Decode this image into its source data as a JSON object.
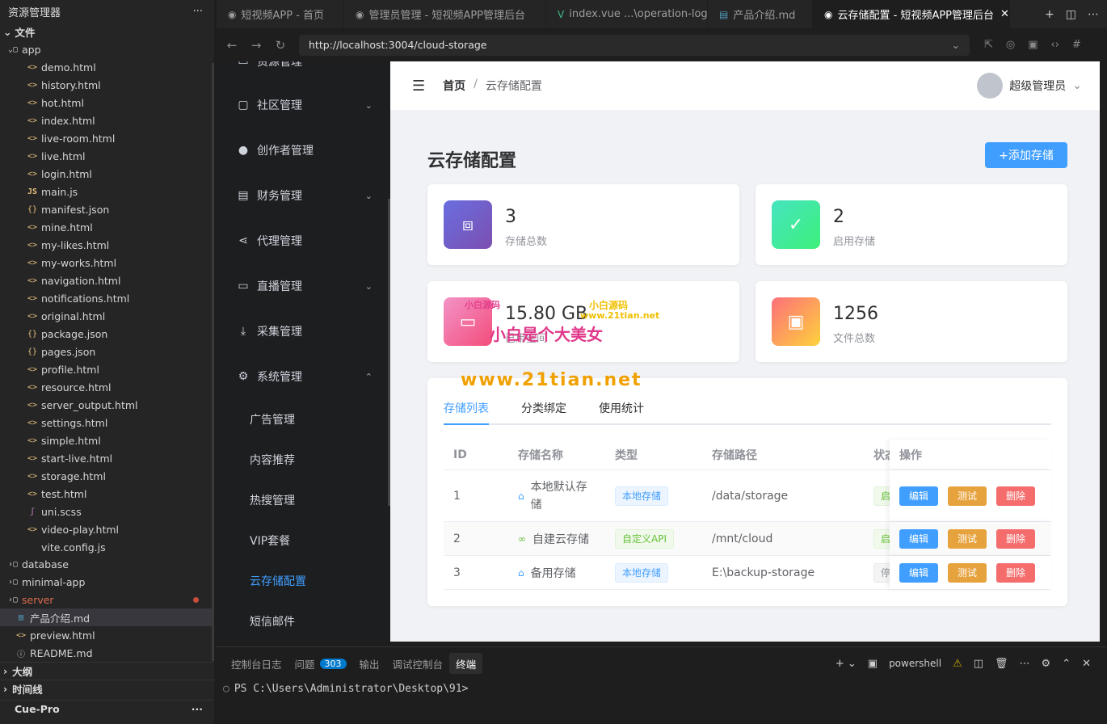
{
  "explorer": {
    "title": "资源管理器",
    "more": "···",
    "section": "文件",
    "folder_app": "app",
    "files": [
      {
        "name": "demo.html",
        "kind": "html"
      },
      {
        "name": "history.html",
        "kind": "html"
      },
      {
        "name": "hot.html",
        "kind": "html"
      },
      {
        "name": "index.html",
        "kind": "html"
      },
      {
        "name": "live-room.html",
        "kind": "html"
      },
      {
        "name": "live.html",
        "kind": "html"
      },
      {
        "name": "login.html",
        "kind": "html"
      },
      {
        "name": "main.js",
        "kind": "js"
      },
      {
        "name": "manifest.json",
        "kind": "json"
      },
      {
        "name": "mine.html",
        "kind": "html"
      },
      {
        "name": "my-likes.html",
        "kind": "html"
      },
      {
        "name": "my-works.html",
        "kind": "html"
      },
      {
        "name": "navigation.html",
        "kind": "html"
      },
      {
        "name": "notifications.html",
        "kind": "html"
      },
      {
        "name": "original.html",
        "kind": "html"
      },
      {
        "name": "package.json",
        "kind": "json"
      },
      {
        "name": "pages.json",
        "kind": "json"
      },
      {
        "name": "profile.html",
        "kind": "html"
      },
      {
        "name": "resource.html",
        "kind": "html"
      },
      {
        "name": "server_output.html",
        "kind": "html"
      },
      {
        "name": "settings.html",
        "kind": "html"
      },
      {
        "name": "simple.html",
        "kind": "html"
      },
      {
        "name": "start-live.html",
        "kind": "html"
      },
      {
        "name": "storage.html",
        "kind": "html"
      },
      {
        "name": "test.html",
        "kind": "html"
      },
      {
        "name": "uni.scss",
        "kind": "scss"
      },
      {
        "name": "video-play.html",
        "kind": "html"
      },
      {
        "name": "vite.config.js",
        "kind": "none"
      }
    ],
    "folders": [
      "database",
      "minimal-app",
      "server"
    ],
    "root_files": [
      "产品介绍.md",
      "preview.html",
      "README.md"
    ],
    "outline": "大纲",
    "timeline": "时间线",
    "cue_pro": "Cue-Pro"
  },
  "tabs": [
    {
      "label": "短视频APP - 首页"
    },
    {
      "label": "管理员管理 - 短视频APP管理后台"
    },
    {
      "label": "index.vue  ...\\operation-log"
    },
    {
      "label": "产品介绍.md"
    },
    {
      "label": "云存储配置 - 短视频APP管理后台"
    }
  ],
  "address": {
    "url": "http://localhost:3004/cloud-storage"
  },
  "sidebar": {
    "partial": "资源管理",
    "items": [
      {
        "label": "社区管理"
      },
      {
        "label": "创作者管理"
      },
      {
        "label": "财务管理"
      },
      {
        "label": "代理管理"
      },
      {
        "label": "直播管理"
      },
      {
        "label": "采集管理"
      },
      {
        "label": "系统管理"
      }
    ],
    "sub": [
      {
        "label": "广告管理"
      },
      {
        "label": "内容推荐"
      },
      {
        "label": "热搜管理"
      },
      {
        "label": "VIP套餐"
      },
      {
        "label": "云存储配置"
      },
      {
        "label": "短信邮件"
      }
    ]
  },
  "header": {
    "home": "首页",
    "sep": "/",
    "current": "云存储配置",
    "user": "超级管理员"
  },
  "main": {
    "title": "云存储配置",
    "add_button": "+添加存储",
    "stats": [
      {
        "value": "3",
        "label": "存储总数",
        "color": "#6a5acd"
      },
      {
        "value": "2",
        "label": "启用存储",
        "color": "#3ee08f"
      },
      {
        "value": "15.80 GB",
        "label": "已用空间",
        "color": "#f56fa1"
      },
      {
        "value": "1256",
        "label": "文件总数",
        "color": "#fd8c5b"
      }
    ],
    "table_tabs": [
      "存储列表",
      "分类绑定",
      "使用统计"
    ],
    "columns": [
      "ID",
      "存储名称",
      "类型",
      "存储路径",
      "状态",
      "操作"
    ],
    "rows": [
      {
        "id": "1",
        "name": "本地默认存储",
        "type": "本地存储",
        "path": "/data/storage",
        "status": "启用"
      },
      {
        "id": "2",
        "name": "自建云存储",
        "type": "自定义API",
        "path": "/mnt/cloud",
        "status": "启用"
      },
      {
        "id": "3",
        "name": "备用存储",
        "type": "本地存储",
        "path": "E:\\backup-storage",
        "status": "停用"
      }
    ],
    "ops": {
      "edit": "编辑",
      "test": "测试",
      "delete": "删除"
    }
  },
  "watermarks": {
    "w1": "小白源码",
    "w2": "www.21tian.net",
    "w3": "小白是个大美女",
    "w4": "小白源码",
    "w5": "www.21tian.net"
  },
  "panel": {
    "tabs": [
      "控制台日志",
      "问题",
      "输出",
      "调试控制台",
      "终端"
    ],
    "problems_count": "303",
    "shell": "powershell",
    "prompt": "PS C:\\Users\\Administrator\\Desktop\\91>"
  }
}
